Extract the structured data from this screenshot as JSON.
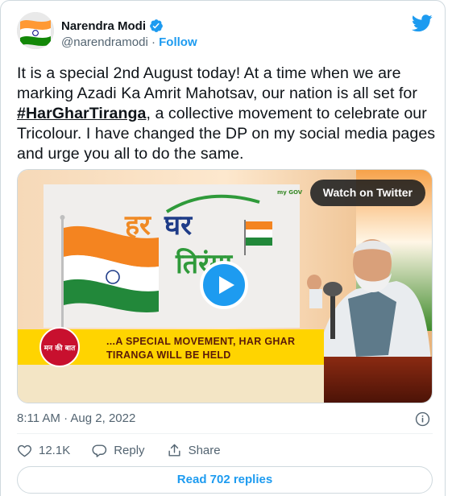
{
  "author": {
    "display_name": "Narendra Modi",
    "handle": "@narendramodi",
    "separator": " · ",
    "follow_label": "Follow",
    "verified": true
  },
  "tweet": {
    "text_part1": "It is a special 2nd August today! At a time when we are marking Azadi Ka Amrit Mahotsav, our nation is all set for ",
    "hashtag": "#HarGharTiranga",
    "text_part2": ", a collective movement to celebrate our Tricolour. I have changed the DP on my social media pages and urge you all to do the same."
  },
  "media": {
    "watch_label": "Watch on Twitter",
    "banner_line1": "...A SPECIAL MOVEMENT, HAR GHAR",
    "banner_line2": "TIRANGA WILL BE HELD",
    "logo_text": "मन की बात",
    "mygov_text": "my GOV"
  },
  "meta": {
    "timestamp": "8:11 AM · Aug 2, 2022"
  },
  "actions": {
    "likes": "12.1K",
    "reply_label": "Reply",
    "share_label": "Share"
  },
  "footer": {
    "read_replies_label": "Read 702 replies"
  },
  "colors": {
    "accent": "#1d9bf0",
    "saffron": "#ff9933",
    "green": "#138808",
    "banner_yellow": "#ffd400",
    "banner_red": "#c8102e"
  }
}
